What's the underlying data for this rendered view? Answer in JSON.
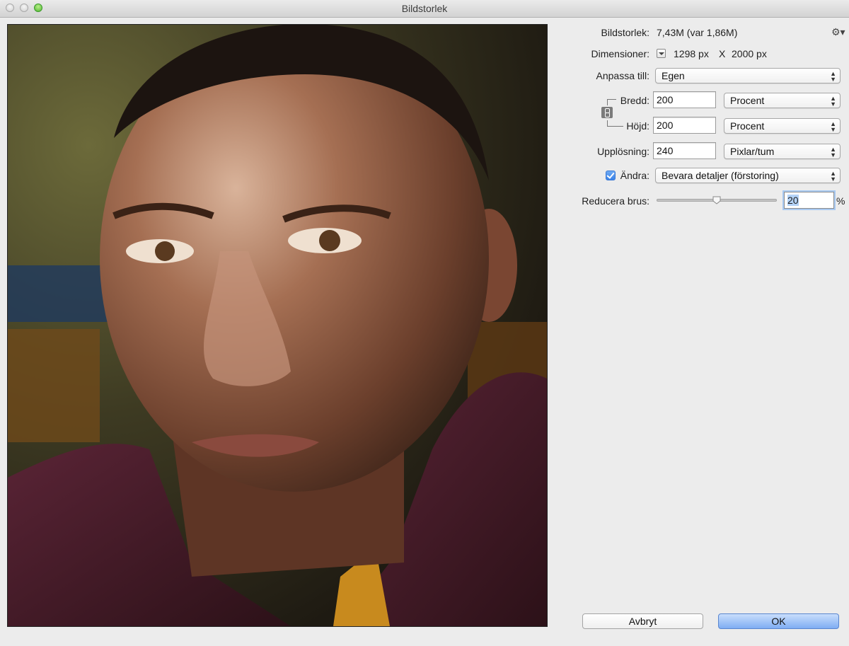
{
  "window": {
    "title": "Bildstorlek"
  },
  "image_size": {
    "label": "Bildstorlek:",
    "value": "7,43M (var 1,86M)"
  },
  "dimensions": {
    "label": "Dimensioner:",
    "width": "1298 px",
    "separator": "X",
    "height": "2000 px"
  },
  "fit_to": {
    "label": "Anpassa till:",
    "value": "Egen"
  },
  "width": {
    "label": "Bredd:",
    "value": "200",
    "unit": "Procent"
  },
  "height": {
    "label": "Höjd:",
    "value": "200",
    "unit": "Procent"
  },
  "resolution": {
    "label": "Upplösning:",
    "value": "240",
    "unit": "Pixlar/tum"
  },
  "resample": {
    "label": "Ändra:",
    "checked": true,
    "method": "Bevara detaljer (förstoring)"
  },
  "noise": {
    "label": "Reducera brus:",
    "value": "20",
    "unit": "%",
    "slider_fraction": 0.5
  },
  "buttons": {
    "cancel": "Avbryt",
    "ok": "OK"
  },
  "icons": {
    "settings": "gear-icon",
    "constrain": "chain-link-icon",
    "dimensions_menu": "dropdown-triangle-icon"
  },
  "colors": {
    "ok_button": "#7fadf3",
    "checkbox": "#3a82e8",
    "focus_ring": "#a8c9f2"
  }
}
